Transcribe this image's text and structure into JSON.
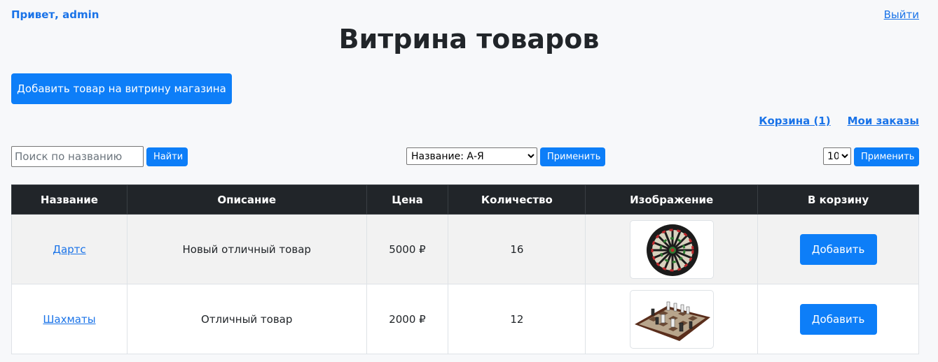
{
  "header": {
    "greeting": "Привет, admin",
    "logout": "Выйти",
    "title": "Витрина товаров",
    "add_product": "Добавить товар на витрину магазина"
  },
  "links": {
    "cart": "Корзина (1)",
    "orders": "Мои заказы"
  },
  "controls": {
    "search_placeholder": "Поиск по названию",
    "search_value": "",
    "find_label": "Найти",
    "sort_selected": "Название: А-Я",
    "apply_label": "Применить",
    "per_page_selected": "10"
  },
  "table": {
    "headers": [
      "Название",
      "Описание",
      "Цена",
      "Количество",
      "Изображение",
      "В корзину"
    ],
    "rows": [
      {
        "name": "Дартс",
        "description": "Новый отличный товар",
        "price": "5000 ₽",
        "quantity": "16",
        "image": "dartboard-image",
        "action": "Добавить"
      },
      {
        "name": "Шахматы",
        "description": "Отличный товар",
        "price": "2000 ₽",
        "quantity": "12",
        "image": "chess-image",
        "action": "Добавить"
      }
    ]
  },
  "colors": {
    "accent": "#0d7ef8",
    "link": "#1a73e8",
    "table_header": "#212529"
  }
}
